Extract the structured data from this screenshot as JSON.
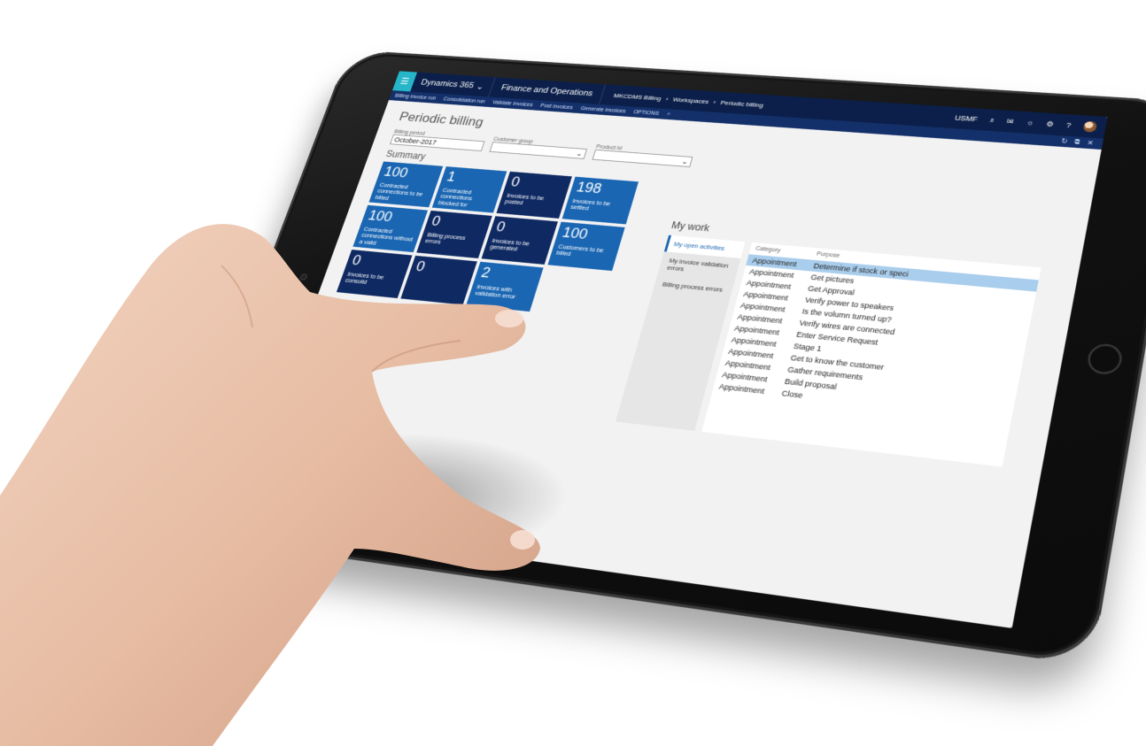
{
  "app": {
    "brand": "Dynamics 365",
    "module": "Finance and Operations",
    "breadcrumbs": [
      "MKCDMS Billing",
      "Workspaces",
      "Periodic billing"
    ],
    "user": "USMF"
  },
  "action_pane": {
    "items": [
      "Billing invoice run",
      "Consolidation run",
      "Validate invoices",
      "Post invoices",
      "Generate invoices",
      "OPTIONS"
    ]
  },
  "page": {
    "title": "Periodic billing",
    "filters": {
      "billing_period_label": "Billing period",
      "billing_period_value": "October-2017",
      "customer_group_label": "Customer group",
      "customer_group_value": "",
      "product_id_label": "Product Id",
      "product_id_value": ""
    },
    "summary_label": "Summary"
  },
  "tiles": [
    {
      "count": "100",
      "label": "Contracted connections to be billed",
      "style": "light"
    },
    {
      "count": "1",
      "label": "Contracted connections blocked for",
      "style": "light"
    },
    {
      "count": "0",
      "label": "Invoices to be posted",
      "style": "dark"
    },
    {
      "count": "198",
      "label": "Invoices to be settled",
      "style": "light"
    },
    {
      "count": "100",
      "label": "Contracted connections without a valid",
      "style": "light"
    },
    {
      "count": "0",
      "label": "Billing process errors",
      "style": "dark"
    },
    {
      "count": "0",
      "label": "Invoices to be generated",
      "style": "dark"
    },
    {
      "count": "100",
      "label": "Customers to be billed",
      "style": "light"
    },
    {
      "count": "0",
      "label": "Invoices to be consolid",
      "style": "dark"
    },
    {
      "count": "0",
      "label": "",
      "style": "dark"
    },
    {
      "count": "2",
      "label": "Invoices with validation error",
      "style": "light"
    }
  ],
  "my_work": {
    "title": "My work",
    "tabs": [
      "My open activities",
      "My invoice validation errors",
      "Billing process errors"
    ],
    "columns": [
      "Category",
      "Purpose"
    ],
    "rows": [
      {
        "category": "Appointment",
        "purpose": "Determine if stock or speci"
      },
      {
        "category": "Appointment",
        "purpose": "Get pictures"
      },
      {
        "category": "Appointment",
        "purpose": "Get Approval"
      },
      {
        "category": "Appointment",
        "purpose": "Verify power to speakers"
      },
      {
        "category": "Appointment",
        "purpose": "Is the volumn turned up?"
      },
      {
        "category": "Appointment",
        "purpose": "Verify wires are connected"
      },
      {
        "category": "Appointment",
        "purpose": "Enter Service Request"
      },
      {
        "category": "Appointment",
        "purpose": "Stage 1"
      },
      {
        "category": "Appointment",
        "purpose": "Get to know the customer"
      },
      {
        "category": "Appointment",
        "purpose": "Gather requirements"
      },
      {
        "category": "Appointment",
        "purpose": "Build proposal"
      },
      {
        "category": "Appointment",
        "purpose": "Close"
      }
    ]
  },
  "colors": {
    "topbar": "#0b1f4a",
    "tile_light": "#1a66b3",
    "tile_dark": "#0f2a63",
    "accent": "#26b6c9",
    "selected_row": "#a9cdec"
  }
}
